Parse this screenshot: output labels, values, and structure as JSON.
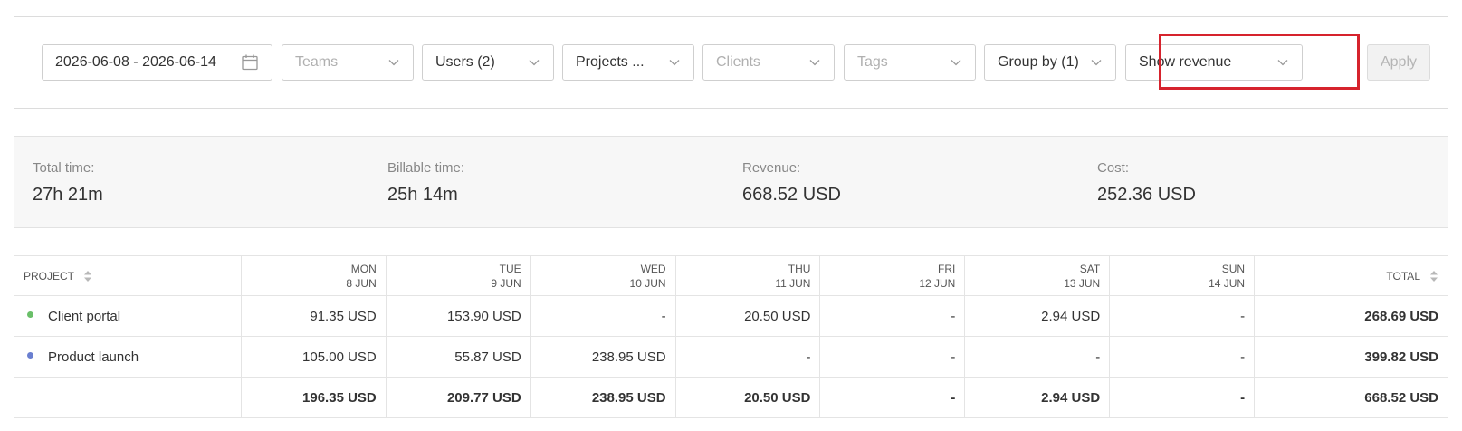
{
  "filters": {
    "date_range": "2026-06-08 - 2026-06-14",
    "teams": "Teams",
    "users": "Users (2)",
    "projects": "Projects ...",
    "clients": "Clients",
    "tags": "Tags",
    "group_by": "Group by (1)",
    "show": "Show revenue",
    "apply_label": "Apply"
  },
  "summary": {
    "total_time_label": "Total time:",
    "total_time_value": "27h 21m",
    "billable_time_label": "Billable time:",
    "billable_time_value": "25h 14m",
    "revenue_label": "Revenue:",
    "revenue_value": "668.52 USD",
    "cost_label": "Cost:",
    "cost_value": "252.36 USD"
  },
  "table": {
    "project_header": "PROJECT",
    "total_header": "TOTAL",
    "days": [
      {
        "day": "MON",
        "date": "8 JUN"
      },
      {
        "day": "TUE",
        "date": "9 JUN"
      },
      {
        "day": "WED",
        "date": "10 JUN"
      },
      {
        "day": "THU",
        "date": "11 JUN"
      },
      {
        "day": "FRI",
        "date": "12 JUN"
      },
      {
        "day": "SAT",
        "date": "13 JUN"
      },
      {
        "day": "SUN",
        "date": "14 JUN"
      }
    ],
    "rows": [
      {
        "project": "Client portal",
        "color": "#6abf69",
        "values": [
          "91.35 USD",
          "153.90 USD",
          "-",
          "20.50 USD",
          "-",
          "2.94 USD",
          "-"
        ],
        "total": "268.69 USD"
      },
      {
        "project": "Product launch",
        "color": "#6a7fd0",
        "values": [
          "105.00 USD",
          "55.87 USD",
          "238.95 USD",
          "-",
          "-",
          "-",
          "-"
        ],
        "total": "399.82 USD"
      }
    ],
    "totals": {
      "values": [
        "196.35 USD",
        "209.77 USD",
        "238.95 USD",
        "20.50 USD",
        "-",
        "2.94 USD",
        "-"
      ],
      "total": "668.52 USD"
    }
  },
  "colors": {
    "highlight": "#d6232d"
  }
}
